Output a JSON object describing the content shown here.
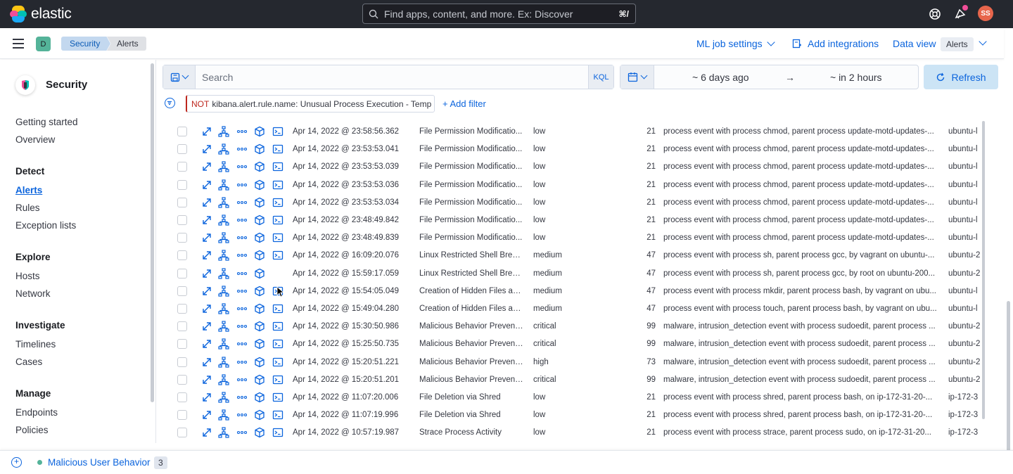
{
  "header": {
    "brand": "elastic",
    "search_placeholder": "Find apps, content, and more. Ex: Discover",
    "search_shortcut": "⌘/",
    "avatar_initials": "SS"
  },
  "subheader": {
    "space_initial": "D",
    "breadcrumbs": [
      "Security",
      "Alerts"
    ],
    "ml_settings": "ML job settings",
    "add_integrations": "Add integrations",
    "data_view_label": "Data view",
    "data_view_value": "Alerts"
  },
  "sidebar": {
    "title": "Security",
    "items": [
      {
        "label": "Getting started",
        "type": "item"
      },
      {
        "label": "Overview",
        "type": "item"
      },
      {
        "label": "Detect",
        "type": "head"
      },
      {
        "label": "Alerts",
        "type": "active"
      },
      {
        "label": "Rules",
        "type": "item"
      },
      {
        "label": "Exception lists",
        "type": "item"
      },
      {
        "label": "Explore",
        "type": "head"
      },
      {
        "label": "Hosts",
        "type": "item"
      },
      {
        "label": "Network",
        "type": "item"
      },
      {
        "label": "Investigate",
        "type": "head"
      },
      {
        "label": "Timelines",
        "type": "item"
      },
      {
        "label": "Cases",
        "type": "item"
      },
      {
        "label": "Manage",
        "type": "head"
      },
      {
        "label": "Endpoints",
        "type": "item"
      },
      {
        "label": "Policies",
        "type": "item"
      }
    ]
  },
  "query": {
    "placeholder": "Search",
    "language": "KQL",
    "date_start": "~ 6 days ago",
    "date_arrow": "→",
    "date_end": "~ in 2 hours",
    "refresh_label": "Refresh"
  },
  "filter": {
    "negation": "NOT",
    "text": "kibana.alert.rule.name: Unusual Process Execution - Temp",
    "add_label": "+ Add filter"
  },
  "alerts": [
    {
      "ts": "Apr 14, 2022 @ 23:58:56.362",
      "rule": "File Permission Modificatio...",
      "severity": "low",
      "risk": "21",
      "reason": "process event with process chmod, parent process update-motd-updates-...",
      "host": "ubuntu-l",
      "session": true
    },
    {
      "ts": "Apr 14, 2022 @ 23:53:53.041",
      "rule": "File Permission Modificatio...",
      "severity": "low",
      "risk": "21",
      "reason": "process event with process chmod, parent process update-motd-updates-...",
      "host": "ubuntu-l",
      "session": true
    },
    {
      "ts": "Apr 14, 2022 @ 23:53:53.039",
      "rule": "File Permission Modificatio...",
      "severity": "low",
      "risk": "21",
      "reason": "process event with process chmod, parent process update-motd-updates-...",
      "host": "ubuntu-l",
      "session": true
    },
    {
      "ts": "Apr 14, 2022 @ 23:53:53.036",
      "rule": "File Permission Modificatio...",
      "severity": "low",
      "risk": "21",
      "reason": "process event with process chmod, parent process update-motd-updates-...",
      "host": "ubuntu-l",
      "session": true
    },
    {
      "ts": "Apr 14, 2022 @ 23:53:53.034",
      "rule": "File Permission Modificatio...",
      "severity": "low",
      "risk": "21",
      "reason": "process event with process chmod, parent process update-motd-updates-...",
      "host": "ubuntu-l",
      "session": true
    },
    {
      "ts": "Apr 14, 2022 @ 23:48:49.842",
      "rule": "File Permission Modificatio...",
      "severity": "low",
      "risk": "21",
      "reason": "process event with process chmod, parent process update-motd-updates-...",
      "host": "ubuntu-l",
      "session": true
    },
    {
      "ts": "Apr 14, 2022 @ 23:48:49.839",
      "rule": "File Permission Modificatio...",
      "severity": "low",
      "risk": "21",
      "reason": "process event with process chmod, parent process update-motd-updates-...",
      "host": "ubuntu-l",
      "session": true
    },
    {
      "ts": "Apr 14, 2022 @ 16:09:20.076",
      "rule": "Linux Restricted Shell Brea...",
      "severity": "medium",
      "risk": "47",
      "reason": "process event with process sh, parent process gcc, by vagrant on ubuntu-...",
      "host": "ubuntu-2",
      "session": true
    },
    {
      "ts": "Apr 14, 2022 @ 15:59:17.059",
      "rule": "Linux Restricted Shell Brea...",
      "severity": "medium",
      "risk": "47",
      "reason": "process event with process sh, parent process gcc, by root on ubuntu-200...",
      "host": "ubuntu-2",
      "session": false
    },
    {
      "ts": "Apr 14, 2022 @ 15:54:05.049",
      "rule": "Creation of Hidden Files an...",
      "severity": "medium",
      "risk": "47",
      "reason": "process event with process mkdir, parent process bash, by vagrant on ubu...",
      "host": "ubuntu-l",
      "session": true
    },
    {
      "ts": "Apr 14, 2022 @ 15:49:04.280",
      "rule": "Creation of Hidden Files an...",
      "severity": "medium",
      "risk": "47",
      "reason": "process event with process touch, parent process bash, by vagrant on ubu...",
      "host": "ubuntu-l",
      "session": true
    },
    {
      "ts": "Apr 14, 2022 @ 15:30:50.986",
      "rule": "Malicious Behavior Preventi...",
      "severity": "critical",
      "risk": "99",
      "reason": "malware, intrusion_detection event with process sudoedit, parent process ...",
      "host": "ubuntu-2",
      "session": true
    },
    {
      "ts": "Apr 14, 2022 @ 15:25:50.735",
      "rule": "Malicious Behavior Preventi...",
      "severity": "critical",
      "risk": "99",
      "reason": "malware, intrusion_detection event with process sudoedit, parent process ...",
      "host": "ubuntu-2",
      "session": true
    },
    {
      "ts": "Apr 14, 2022 @ 15:20:51.221",
      "rule": "Malicious Behavior Preventi...",
      "severity": "high",
      "risk": "73",
      "reason": "malware, intrusion_detection event with process sudoedit, parent process ...",
      "host": "ubuntu-2",
      "session": true
    },
    {
      "ts": "Apr 14, 2022 @ 15:20:51.201",
      "rule": "Malicious Behavior Preventi...",
      "severity": "critical",
      "risk": "99",
      "reason": "malware, intrusion_detection event with process sudoedit, parent process ...",
      "host": "ubuntu-2",
      "session": true
    },
    {
      "ts": "Apr 14, 2022 @ 11:07:20.006",
      "rule": "File Deletion via Shred",
      "severity": "low",
      "risk": "21",
      "reason": "process event with process shred, parent process bash, on ip-172-31-20-...",
      "host": "ip-172-3",
      "session": true
    },
    {
      "ts": "Apr 14, 2022 @ 11:07:19.996",
      "rule": "File Deletion via Shred",
      "severity": "low",
      "risk": "21",
      "reason": "process event with process shred, parent process bash, on ip-172-31-20-...",
      "host": "ip-172-3",
      "session": true
    },
    {
      "ts": "Apr 14, 2022 @ 10:57:19.987",
      "rule": "Strace Process Activity",
      "severity": "low",
      "risk": "21",
      "reason": "process event with process strace, parent process sudo, on ip-172-31-20...",
      "host": "ip-172-3",
      "session": true
    }
  ],
  "timeline_bar": {
    "title": "Malicious User Behavior",
    "count": "3"
  },
  "colors": {
    "accent": "#0b64dd",
    "header_bg": "#25282f",
    "filter_negation": "#bd271e"
  }
}
